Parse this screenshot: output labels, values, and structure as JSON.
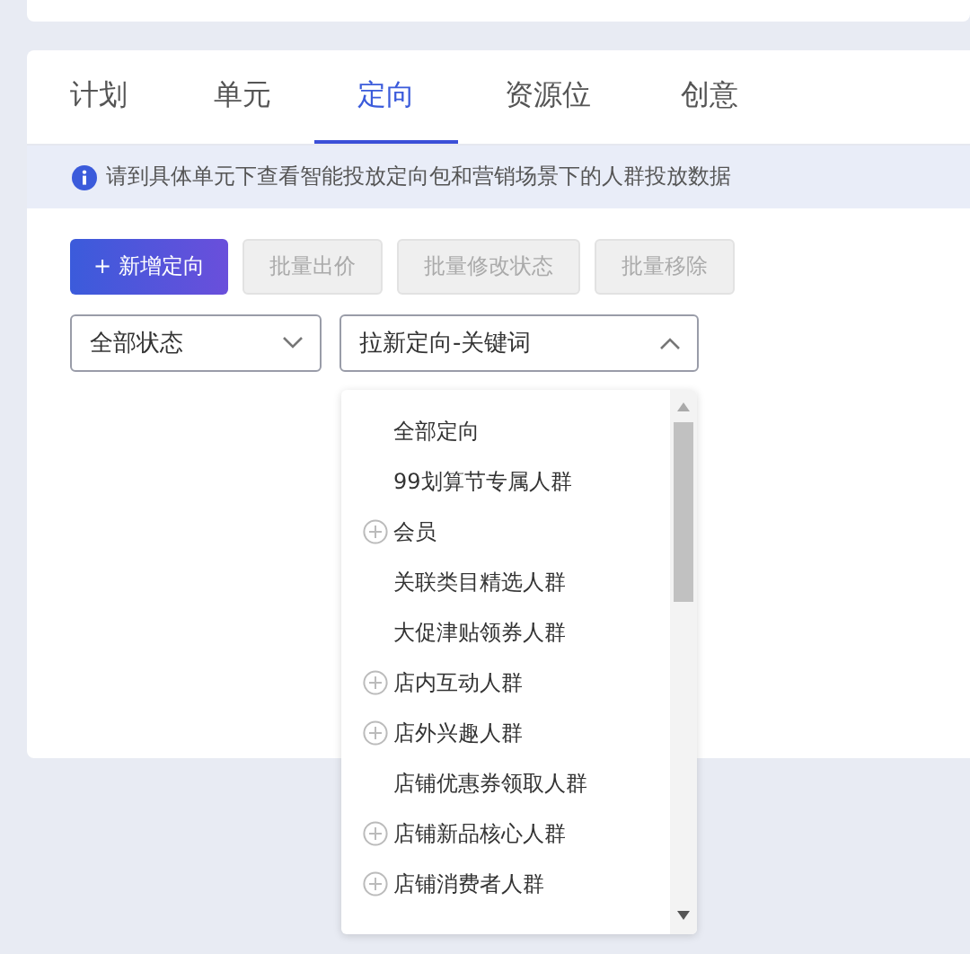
{
  "tabs": [
    {
      "label": "计划",
      "selected": false
    },
    {
      "label": "单元",
      "selected": false
    },
    {
      "label": "定向",
      "selected": true
    },
    {
      "label": "资源位",
      "selected": false
    },
    {
      "label": "创意",
      "selected": false
    }
  ],
  "notice": "请到具体单元下查看智能投放定向包和营销场景下的人群投放数据",
  "buttons": [
    {
      "label": "新增定向",
      "icon": "+",
      "disabled": false,
      "primary": true
    },
    {
      "label": "批量出价",
      "disabled": true,
      "primary": false
    },
    {
      "label": "批量修改状态",
      "disabled": true,
      "primary": false
    },
    {
      "label": "批量移除",
      "disabled": true,
      "primary": false
    }
  ],
  "filters": [
    {
      "value": "全部状态",
      "expanded": false
    },
    {
      "value": "拉新定向-关键词",
      "expanded": true
    }
  ],
  "dropdown_items": [
    {
      "label": "全部定向",
      "expandable": false
    },
    {
      "label": "99划算节专属人群",
      "expandable": false
    },
    {
      "label": "会员",
      "expandable": true
    },
    {
      "label": "关联类目精选人群",
      "expandable": false
    },
    {
      "label": "大促津贴领券人群",
      "expandable": false
    },
    {
      "label": "店内互动人群",
      "expandable": true
    },
    {
      "label": "店外兴趣人群",
      "expandable": true
    },
    {
      "label": "店铺优惠券领取人群",
      "expandable": false
    },
    {
      "label": "店铺新品核心人群",
      "expandable": true
    },
    {
      "label": "店铺消费者人群",
      "expandable": true
    }
  ]
}
